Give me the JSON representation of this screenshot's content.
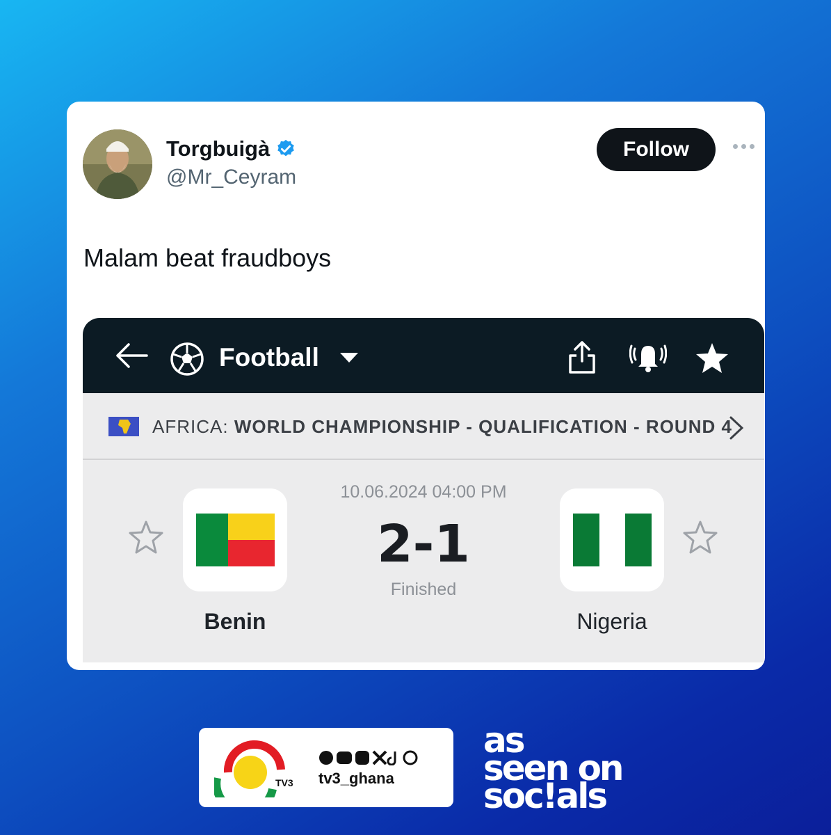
{
  "tweet": {
    "display_name": "Torgbuigà",
    "handle": "@Mr_Ceyram",
    "follow_label": "Follow",
    "text": "Malam beat fraudboys"
  },
  "app": {
    "sport": "Football",
    "competition_region": "AFRICA:",
    "competition_name": "WORLD CHAMPIONSHIP - QUALIFICATION - ROUND 4",
    "datetime": "10.06.2024 04:00 PM",
    "score": "2-1",
    "status": "Finished",
    "home_team": "Benin",
    "away_team": "Nigeria"
  },
  "brand": {
    "tv3_mark": "TV3",
    "handle": "tv3_ghana",
    "socials_logo_lines": [
      "as",
      "seen on",
      "soc!als"
    ]
  },
  "colors": {
    "accent_verified": "#1d9bf0",
    "app_bar": "#0c1b24",
    "benin_green": "#0a8a3c",
    "benin_yellow": "#f8d11a",
    "benin_red": "#e8262f",
    "nigeria_green": "#0a7a35"
  }
}
